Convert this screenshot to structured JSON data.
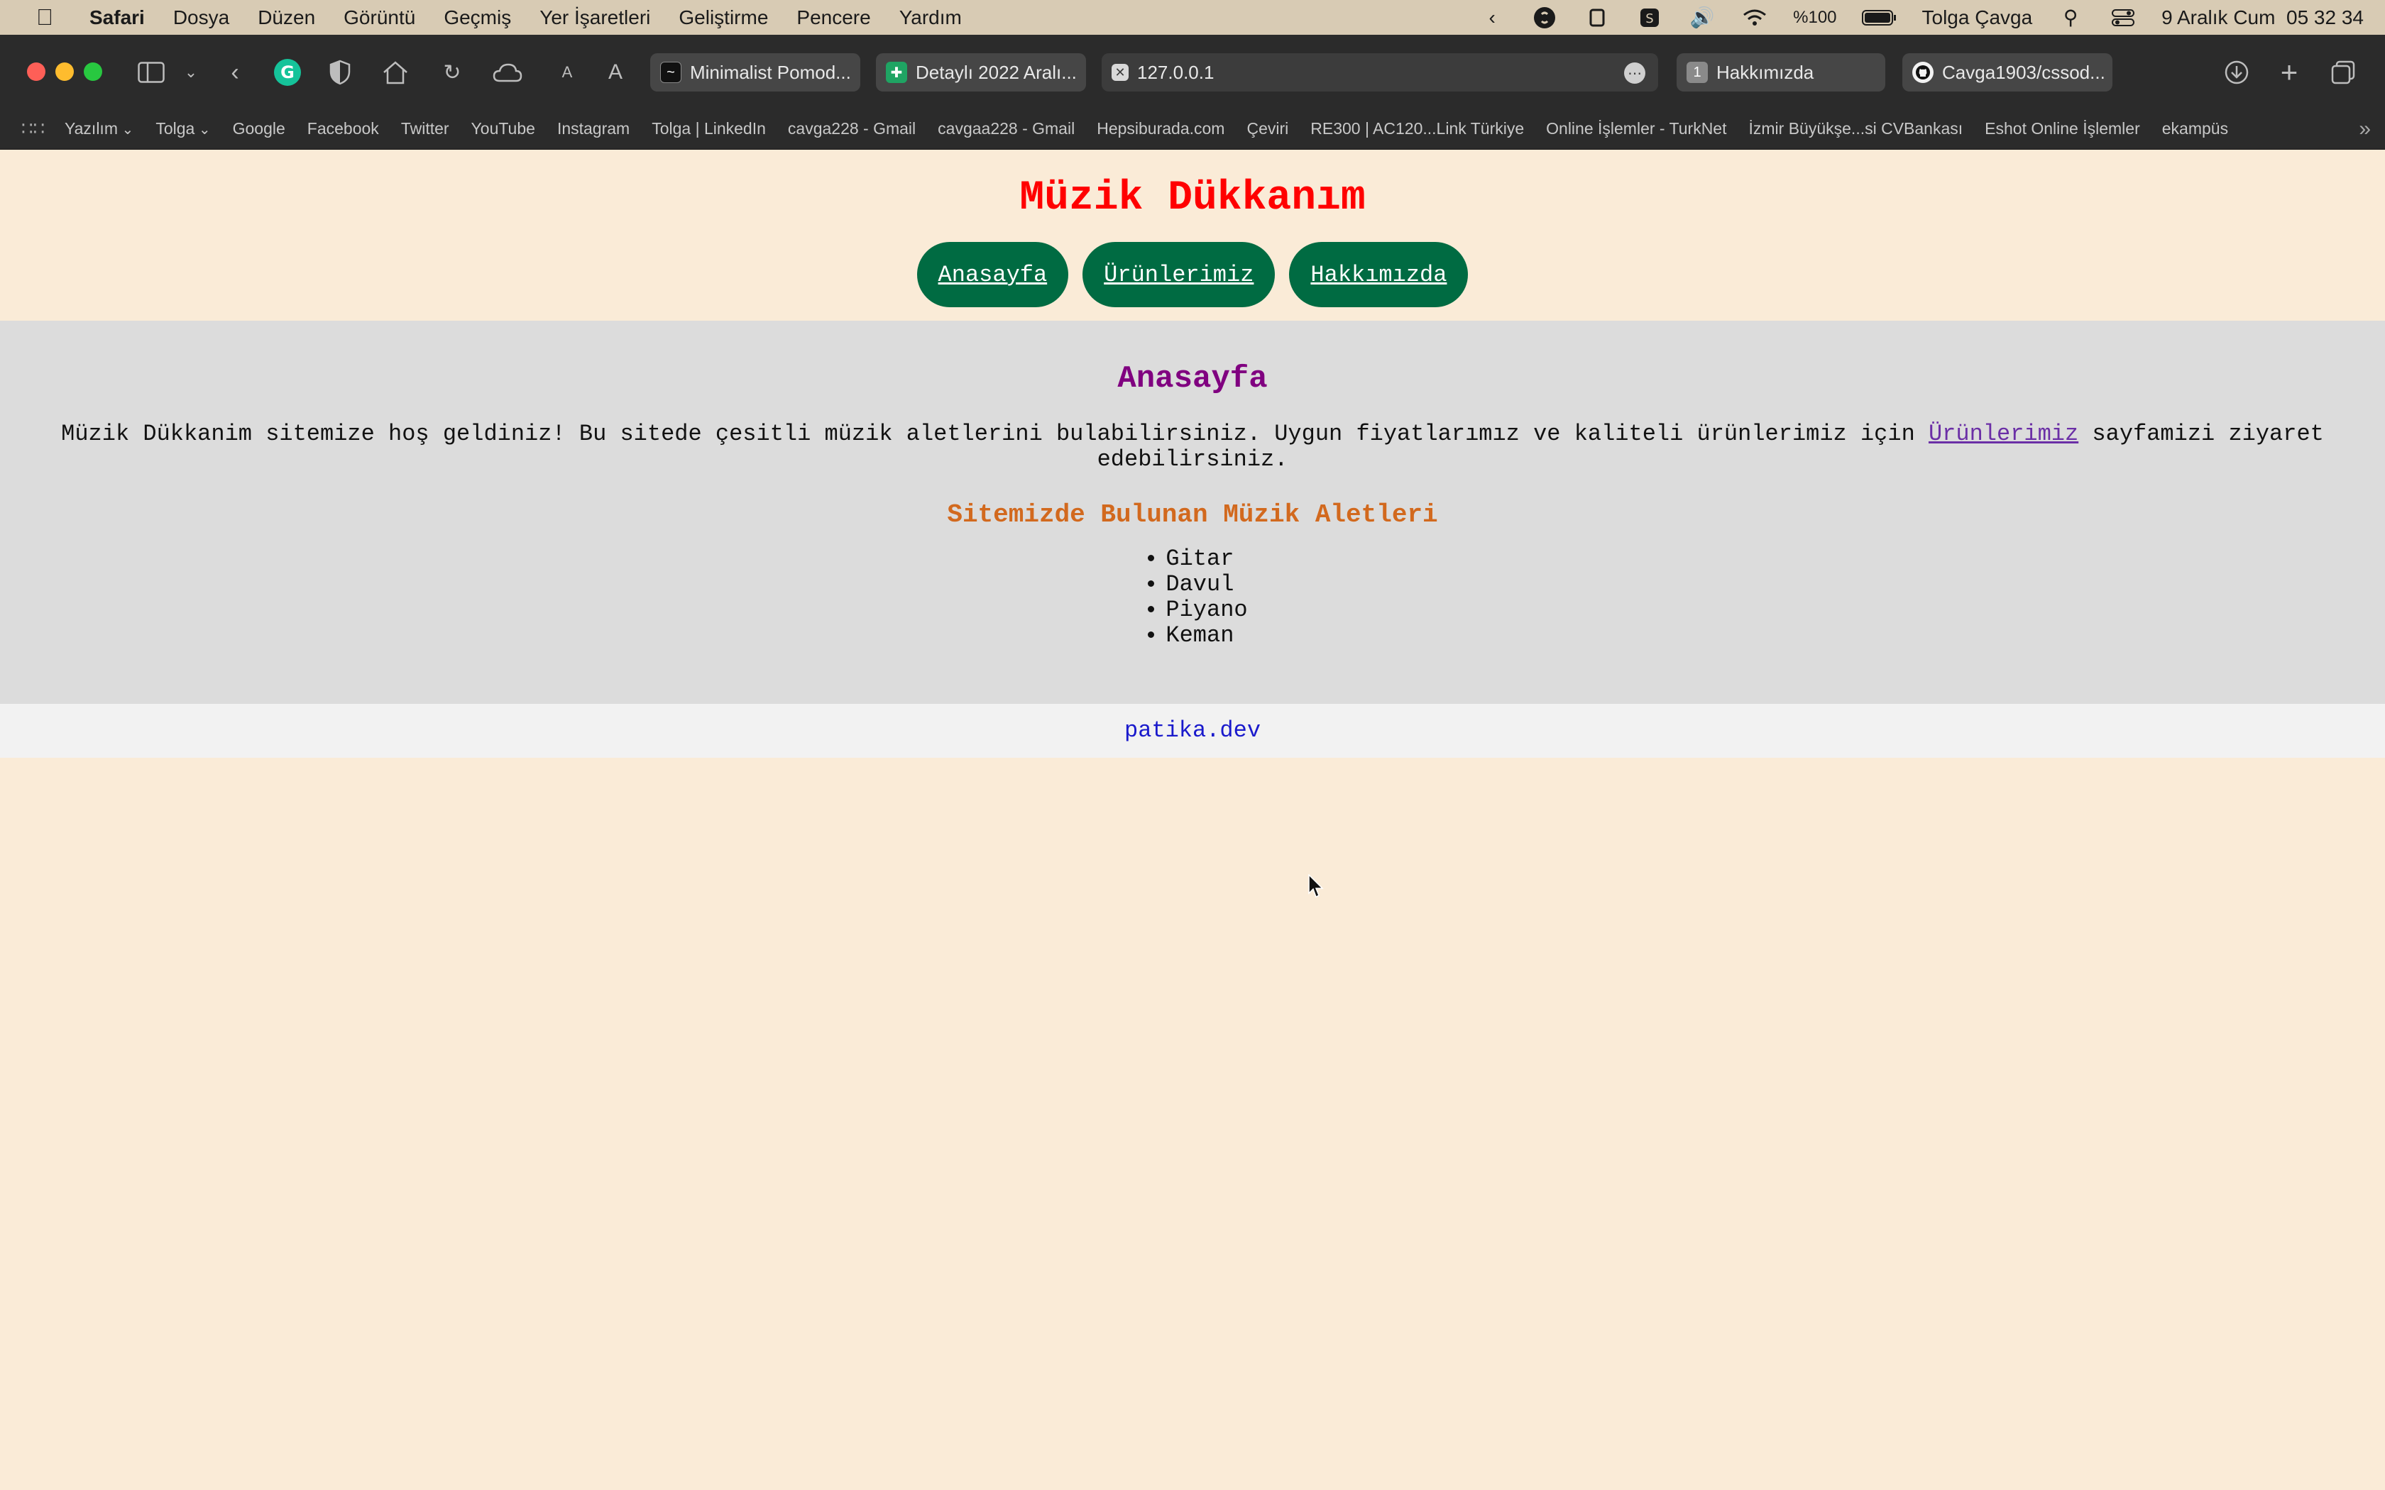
{
  "menubar": {
    "app": "Safari",
    "items": [
      "Dosya",
      "Düzen",
      "Görüntü",
      "Geçmiş",
      "Yer İşaretleri",
      "Geliştirme",
      "Pencere",
      "Yardım"
    ],
    "battery": "%100",
    "user": "Tolga Çavga",
    "datetime": "9 Aralık Cum  05 32 34"
  },
  "tabs": [
    {
      "title": "Minimalist Pomod...",
      "favicon_color": "#111111"
    },
    {
      "title": "Detaylı 2022 Aralı...",
      "favicon_color": "#1fa463"
    },
    {
      "title": "127.0.0.1",
      "favicon_color": "#d9d9d9"
    },
    {
      "title": "Hakkımızda",
      "favicon_color": "#8a8a8a",
      "badge": "1"
    },
    {
      "title": "Cavga1903/cssod...",
      "favicon_color": "#f2f2f2"
    }
  ],
  "bookmarks": [
    {
      "label": "Yazılım",
      "folder": true
    },
    {
      "label": "Tolga",
      "folder": true
    },
    {
      "label": "Google"
    },
    {
      "label": "Facebook"
    },
    {
      "label": "Twitter"
    },
    {
      "label": "YouTube"
    },
    {
      "label": "Instagram"
    },
    {
      "label": "Tolga | LinkedIn"
    },
    {
      "label": "cavga228 - Gmail"
    },
    {
      "label": "cavgaa228 - Gmail"
    },
    {
      "label": "Hepsiburada.com"
    },
    {
      "label": "Çeviri"
    },
    {
      "label": "RE300 | AC120...Link Türkiye"
    },
    {
      "label": "Online İşlemler - TurkNet"
    },
    {
      "label": "İzmir Büyükşe...si CVBankası"
    },
    {
      "label": "Eshot Online İşlemler"
    },
    {
      "label": "ekampüs"
    }
  ],
  "site": {
    "title": "Müzik Dükkanım",
    "nav": [
      "Anasayfa",
      "Ürünlerimiz",
      "Hakkımızda"
    ],
    "heading": "Anasayfa",
    "intro_before": "Müzik Dükkanim sitemize hoş geldiniz! Bu sitede çesitli müzik aletlerini bulabilirsiniz. Uygun fiyatlarımız ve kaliteli ürünlerimiz için ",
    "intro_link": "Ürünlerimiz",
    "intro_after": " sayfamizi ziyaret edebilirsiniz.",
    "subheading": "Sitemizde Bulunan Müzik Aletleri",
    "instruments": [
      "Gitar",
      "Davul",
      "Piyano",
      "Keman"
    ],
    "footer": "patika.dev"
  },
  "colors": {
    "title": "#ff0000",
    "nav_bg": "#006b42",
    "heading": "#800080",
    "subheading": "#d2691e",
    "page_bg": "#faebd7",
    "main_bg": "#dcdcdc",
    "footer_link": "#1a1acc"
  }
}
